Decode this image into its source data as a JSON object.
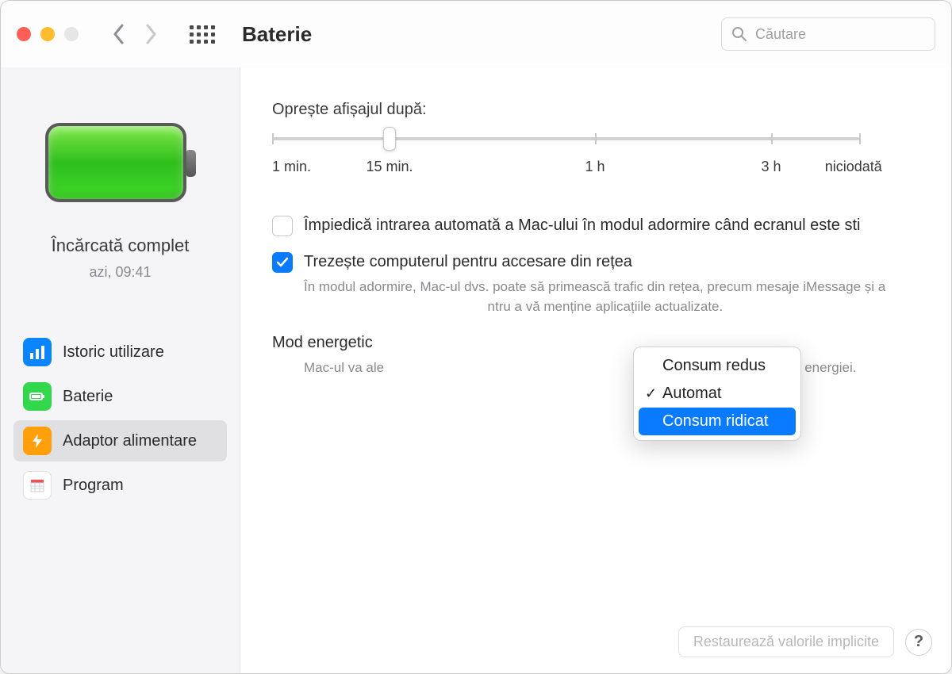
{
  "window": {
    "title": "Baterie",
    "search_placeholder": "Căutare"
  },
  "sidebar": {
    "battery_status": "Încărcată complet",
    "battery_time": "azi, 09:41",
    "items": [
      {
        "label": "Istoric utilizare",
        "icon": "chart-icon",
        "color": "blue",
        "selected": false
      },
      {
        "label": "Baterie",
        "icon": "battery-icon",
        "color": "green",
        "selected": false
      },
      {
        "label": "Adaptor alimentare",
        "icon": "bolt-icon",
        "color": "orange",
        "selected": true
      },
      {
        "label": "Program",
        "icon": "calendar-icon",
        "color": "white",
        "selected": false
      }
    ]
  },
  "main": {
    "slider_label": "Oprește afișajul după:",
    "slider_ticks": [
      "1 min.",
      "15 min.",
      "1 h",
      "3 h",
      "niciodată"
    ],
    "slider_value_index": 1,
    "opt_prevent_sleep": {
      "label": "Împiedică intrarea automată a Mac-ului în modul adormire când ecranul este sti",
      "checked": false
    },
    "opt_wake_network": {
      "label": "Trezește computerul pentru accesare din rețea",
      "checked": true,
      "desc_before": "În modul adormire, Mac-ul dvs. poate să primească trafic din rețea, precum mesaje iMessage și a",
      "desc_after": "ntru a vă menține aplicațiile actualizate."
    },
    "energy_mode": {
      "label": "Mod energetic",
      "desc_before": "Mac-ul va ale",
      "desc_after": "de performanță și utilizare a energiei."
    },
    "dropdown": {
      "items": [
        {
          "label": "Consum redus",
          "checked": false,
          "highlighted": false
        },
        {
          "label": "Automat",
          "checked": true,
          "highlighted": false
        },
        {
          "label": "Consum ridicat",
          "checked": false,
          "highlighted": true
        }
      ]
    },
    "restore_button": "Restaurează valorile implicite",
    "help_button": "?"
  }
}
